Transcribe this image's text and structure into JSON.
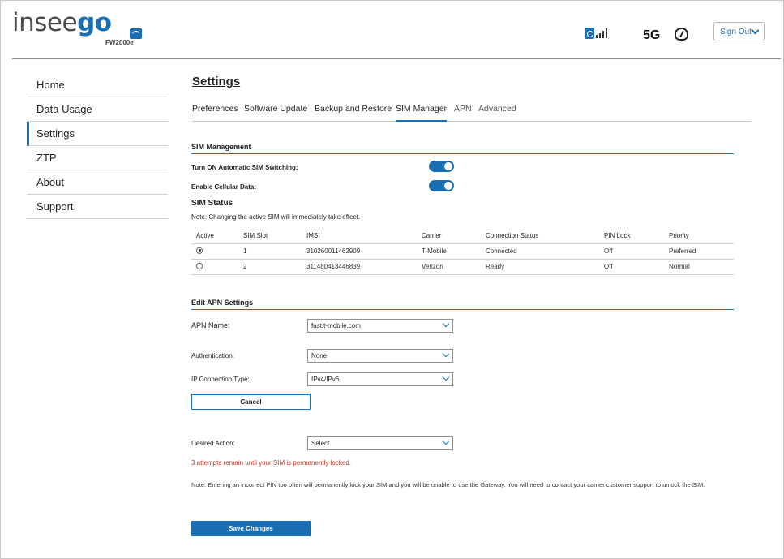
{
  "header": {
    "logo_dark_a": "insee",
    "logo_blue": "go",
    "model": "FW2000e",
    "network": "5G",
    "signout_label": "Sign Out"
  },
  "sidebar": {
    "items": [
      {
        "label": "Home"
      },
      {
        "label": "Data Usage"
      },
      {
        "label": "Settings",
        "active": true
      },
      {
        "label": "ZTP"
      },
      {
        "label": "About"
      },
      {
        "label": "Support"
      }
    ]
  },
  "main": {
    "title": "Settings",
    "tabs": [
      {
        "label": "Preferences"
      },
      {
        "label": "Software Update"
      },
      {
        "label": "Backup and Restore"
      },
      {
        "label": "SIM Manager",
        "active": true
      },
      {
        "label": "APN"
      },
      {
        "label": "Advanced"
      }
    ]
  },
  "sim_management": {
    "title": "SIM Management",
    "auto_switch_label": "Turn ON Automatic SIM Switching:",
    "auto_switch_on": true,
    "cellular_label": "Enable Cellular Data:",
    "cellular_on": true
  },
  "sim_status": {
    "title": "SIM Status",
    "note": "Note: Changing the active SIM will immediately take effect.",
    "columns": [
      "Active",
      "SIM Slot",
      "IMSI",
      "Carrier",
      "Connection Status",
      "PIN Lock",
      "Priority"
    ],
    "rows": [
      {
        "active": true,
        "slot": "1",
        "imsi": "310260011462909",
        "carrier": "T-Mobile",
        "status": "Connected",
        "pin": "Off",
        "priority": "Preferred"
      },
      {
        "active": false,
        "slot": "2",
        "imsi": "311480413446839",
        "carrier": "Verizon",
        "status": "Ready",
        "pin": "Off",
        "priority": "Normal"
      }
    ]
  },
  "apn": {
    "title": "Edit APN Settings",
    "apn_name_label": "APN Name:",
    "apn_name_value": "fast.t-mobile.com",
    "auth_label": "Authentication:",
    "auth_value": "None",
    "ip_type_label": "IP Connection Type:",
    "ip_type_value": "IPv4/IPv6",
    "cancel_label": "Cancel",
    "desired_action_label": "Desired Action:",
    "desired_action_value": "Select",
    "warning": "3 attempts remain until your SIM is permanently locked.",
    "note": "Note: Entering an incorrect PIN too often will permanently lock your SIM and you will be unable to use the Gateway. You will need to contact your carrier customer support to unlock the SIM.",
    "save_label": "Save Changes"
  },
  "colors": {
    "accent": "#1a6fb4",
    "warning": "#b03a2e"
  }
}
